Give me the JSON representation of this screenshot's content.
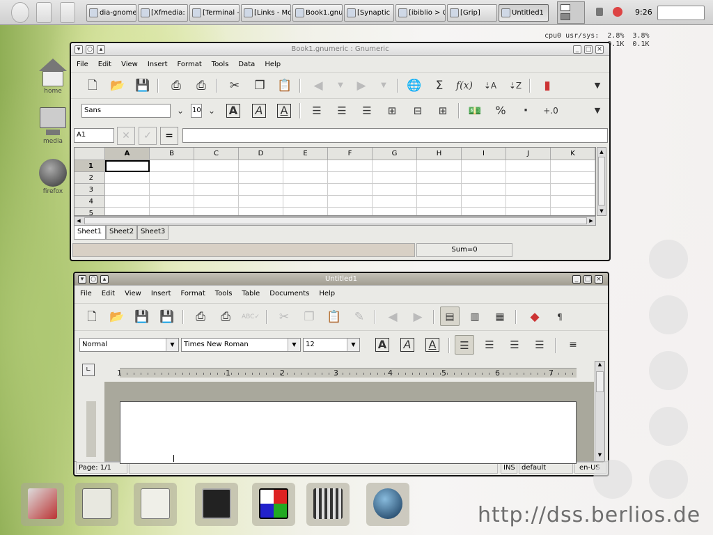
{
  "taskbar": {
    "tasks": [
      "dia-gnome",
      "[Xfmedia:",
      "[Terminal -",
      "[Links - Mo",
      "Book1.gnu",
      "[Synaptic",
      "[ibiblio > C",
      "[Grip]",
      "Untitled1"
    ],
    "clock": "9:26"
  },
  "cpu_monitor": "cpu0 usr/sys:  2.8%  3.8%\n               0.1K  0.1K",
  "desktop_icons": [
    "home",
    "media",
    "firefox"
  ],
  "gnumeric": {
    "title": "Book1.gnumeric : Gnumeric",
    "menu": [
      "File",
      "Edit",
      "View",
      "Insert",
      "Format",
      "Tools",
      "Data",
      "Help"
    ],
    "font_name": "Sans",
    "font_size": "10",
    "cell_ref": "A1",
    "columns": [
      "A",
      "B",
      "C",
      "D",
      "E",
      "F",
      "G",
      "H",
      "I",
      "J",
      "K"
    ],
    "rows": [
      "1",
      "2",
      "3",
      "4",
      "5"
    ],
    "sheets": [
      "Sheet1",
      "Sheet2",
      "Sheet3"
    ],
    "status_sum": "Sum=0",
    "toolbar_labels": {
      "sum": "Σ",
      "fx": "f(x)",
      "percent": "%",
      "dot": "·"
    }
  },
  "abiword": {
    "title": "Untitled1",
    "menu": [
      "File",
      "Edit",
      "View",
      "Insert",
      "Format",
      "Tools",
      "Table",
      "Documents",
      "Help"
    ],
    "style": "Normal",
    "font": "Times New Roman",
    "size": "12",
    "ruler_numbers": [
      "1",
      "1",
      "2",
      "3",
      "4",
      "5",
      "6",
      "7"
    ],
    "status": {
      "page": "Page: 1/1",
      "ins": "INS",
      "mode": "default",
      "lang": "en-US"
    },
    "pilcrow": "¶"
  },
  "watermark_url": "http://dss.berlios.de",
  "icons": {
    "bold": "A",
    "italic": "A",
    "underline": "A"
  }
}
